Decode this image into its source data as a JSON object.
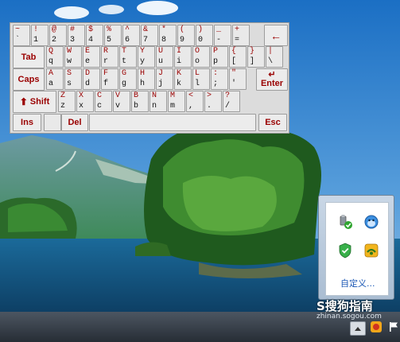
{
  "keyboard": {
    "rows": [
      [
        [
          "~",
          "`"
        ],
        [
          "!",
          "1"
        ],
        [
          "@",
          "2"
        ],
        [
          "#",
          "3"
        ],
        [
          "$",
          "4"
        ],
        [
          "%",
          "5"
        ],
        [
          "^",
          "6"
        ],
        [
          "&",
          "7"
        ],
        [
          "*",
          "8"
        ],
        [
          "(",
          "9"
        ],
        [
          ")",
          "0"
        ],
        [
          "_",
          "-"
        ],
        [
          "+",
          "="
        ]
      ],
      [
        [
          "Q",
          "q"
        ],
        [
          "W",
          "w"
        ],
        [
          "E",
          "e"
        ],
        [
          "R",
          "r"
        ],
        [
          "T",
          "t"
        ],
        [
          "Y",
          "y"
        ],
        [
          "U",
          "u"
        ],
        [
          "I",
          "i"
        ],
        [
          "O",
          "o"
        ],
        [
          "P",
          "p"
        ],
        [
          "{",
          "["
        ],
        [
          "}",
          "]"
        ],
        [
          "|",
          "\\"
        ]
      ],
      [
        [
          "A",
          "a"
        ],
        [
          "S",
          "s"
        ],
        [
          "D",
          "d"
        ],
        [
          "F",
          "f"
        ],
        [
          "G",
          "g"
        ],
        [
          "H",
          "h"
        ],
        [
          "J",
          "j"
        ],
        [
          "K",
          "k"
        ],
        [
          "L",
          "l"
        ],
        [
          ":",
          ";"
        ],
        [
          "\"",
          "'"
        ]
      ],
      [
        [
          "Z",
          "z"
        ],
        [
          "X",
          "x"
        ],
        [
          "C",
          "c"
        ],
        [
          "V",
          "v"
        ],
        [
          "B",
          "b"
        ],
        [
          "N",
          "n"
        ],
        [
          "M",
          "m"
        ],
        [
          "<",
          ","
        ],
        [
          ">",
          "."
        ],
        [
          "?",
          "/"
        ]
      ]
    ],
    "tab_label": "Tab",
    "caps_label": "Caps",
    "shift_label": "Shift",
    "enter_label": "Enter",
    "ins_label": "Ins",
    "del_label": "Del",
    "esc_label": "Esc",
    "backspace_symbol": "←"
  },
  "tray_popup": {
    "customize_label": "自定义..."
  },
  "watermark": {
    "brand": "S搜狗指南",
    "site": "zhinan.sogou.com"
  },
  "colors": {
    "key_upper": "#9a0000",
    "key_lower": "#111111",
    "taskbar": "#2d333b"
  }
}
